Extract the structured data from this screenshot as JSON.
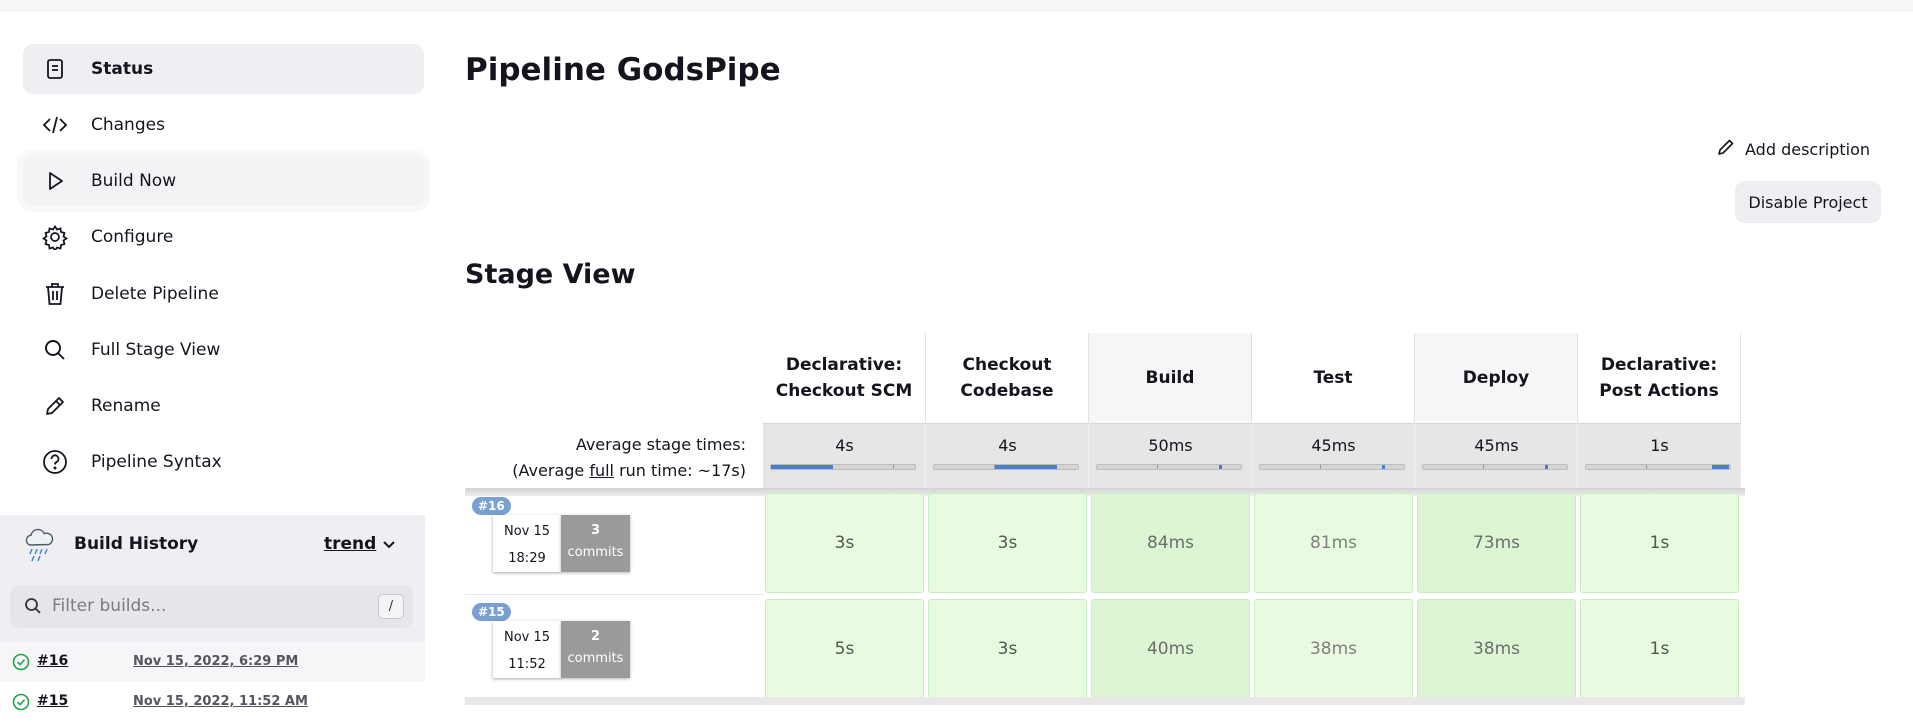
{
  "sidebar": {
    "tasks": [
      {
        "label": "Status",
        "icon": "document-icon"
      },
      {
        "label": "Changes",
        "icon": "code-icon"
      },
      {
        "label": "Build Now",
        "icon": "play-icon"
      },
      {
        "label": "Configure",
        "icon": "gear-icon"
      },
      {
        "label": "Delete Pipeline",
        "icon": "trash-icon"
      },
      {
        "label": "Full Stage View",
        "icon": "search-icon"
      },
      {
        "label": "Rename",
        "icon": "pencil-icon"
      },
      {
        "label": "Pipeline Syntax",
        "icon": "help-icon"
      }
    ]
  },
  "build_history": {
    "title": "Build History",
    "trend": "trend",
    "filter_placeholder": "Filter builds...",
    "shortcut": "/",
    "builds": [
      {
        "number": "#16",
        "date": "Nov 15, 2022, 6:29 PM",
        "status": "success"
      },
      {
        "number": "#15",
        "date": "Nov 15, 2022, 11:52 AM",
        "status": "success"
      }
    ]
  },
  "main": {
    "title": "Pipeline GodsPipe",
    "add_description": "Add description",
    "disable_project": "Disable Project",
    "stage_view_title": "Stage View"
  },
  "stage_view": {
    "avg_label": "Average stage times:",
    "avg_full_prefix": "(Average ",
    "avg_full_word": "full",
    "avg_full_suffix": " run time: ~17s)",
    "stages": [
      {
        "name": "Declarative: Checkout SCM",
        "avg": "4s",
        "bar_fill": 0.43
      },
      {
        "name": "Checkout Codebase",
        "avg": "4s",
        "bar_fill": 0.43
      },
      {
        "name": "Build",
        "avg": "50ms",
        "bar_fill": 0.02
      },
      {
        "name": "Test",
        "avg": "45ms",
        "bar_fill": 0.02
      },
      {
        "name": "Deploy",
        "avg": "45ms",
        "bar_fill": 0.02
      },
      {
        "name": "Declarative: Post Actions",
        "avg": "1s",
        "bar_fill": 0.12
      }
    ],
    "runs": [
      {
        "badge": "#16",
        "date": "Nov 15",
        "time": "18:29",
        "commits": "3",
        "commits_word": "commits",
        "durations": [
          "3s",
          "3s",
          "84ms",
          "81ms",
          "73ms",
          "1s"
        ]
      },
      {
        "badge": "#15",
        "date": "Nov 15",
        "time": "11:52",
        "commits": "2",
        "commits_word": "commits",
        "durations": [
          "5s",
          "3s",
          "40ms",
          "38ms",
          "38ms",
          "1s"
        ]
      }
    ]
  },
  "colors": {
    "accent": "#4a7fd0",
    "success": "#1ea446",
    "cell_bg": "#e8fbe0",
    "badge": "#7aa0cf"
  }
}
